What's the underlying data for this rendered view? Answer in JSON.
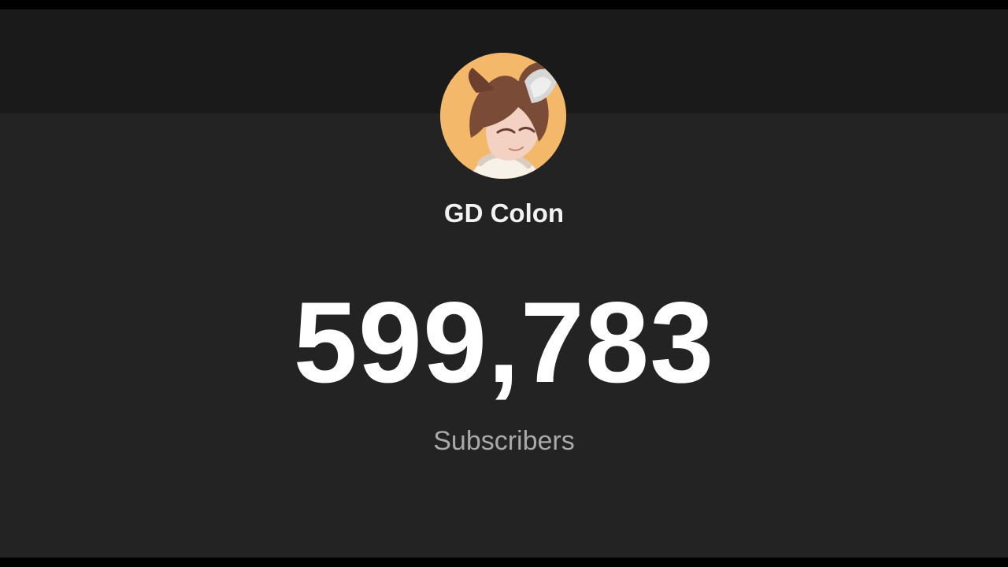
{
  "channel": {
    "name": "GD Colon",
    "avatar_icon": "anime-avatar-icon",
    "subscriber_count": "599,783",
    "subscriber_label": "Subscribers"
  },
  "colors": {
    "background": "#232323",
    "banner": "#1a1a1a",
    "letterbox": "#000000",
    "count_text": "#ffffff",
    "name_text": "#f2f2f2",
    "label_text": "#a9a9a9",
    "avatar_background": "#f4b86a"
  }
}
